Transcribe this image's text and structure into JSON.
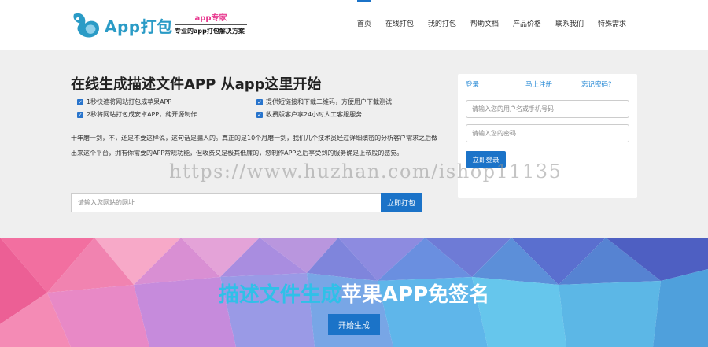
{
  "header": {
    "logo_text": "App打包",
    "slogan_title": "app专家",
    "slogan_sub": "专业的app打包解决方案",
    "nav": [
      {
        "label": "首页",
        "active": true
      },
      {
        "label": "在线打包",
        "active": false
      },
      {
        "label": "我的打包",
        "active": false
      },
      {
        "label": "帮助文档",
        "active": false
      },
      {
        "label": "产品价格",
        "active": false
      },
      {
        "label": "联系我们",
        "active": false
      },
      {
        "label": "特殊需求",
        "active": false
      }
    ]
  },
  "hero": {
    "title": "在线生成描述文件APP 从app这里开始",
    "features": [
      "1秒快速将网站打包成苹果APP",
      "提供短链接和下载二维码，方便用户下载测试",
      "2秒将网站打包成安卓APP，纯开源制作",
      "收费版客户享24小时人工客服服务"
    ],
    "description": "十年磨一剑，不，还是不要这样说，这句话是骗人的。真正的是10个月磨一剑，我们几个技术员经过详细缜密的分析客户需求之后做出来这个平台，拥有你需要的APP常规功能，但收费又是极其低廉的，您制作APP之后享受到的服务确是上帝般的感觉。",
    "url_placeholder": "请输入您网站的网址",
    "url_button": "立即打包"
  },
  "login": {
    "tabs": [
      "登录",
      "马上注册",
      "忘记密码?"
    ],
    "username_placeholder": "请输入您的用户名或手机号码",
    "password_placeholder": "请输入您的密码",
    "submit": "立即登录"
  },
  "watermark": "https://www.huzhan.com/ishop11135",
  "banner": {
    "title_highlight": "描述文件生成",
    "title_rest": "苹果APP免签名",
    "button": "开始生成"
  },
  "colors": {
    "primary": "#1b73c8",
    "logo": "#2a9bc6",
    "slogan": "#e8388f",
    "highlight": "#2fc0e8"
  }
}
